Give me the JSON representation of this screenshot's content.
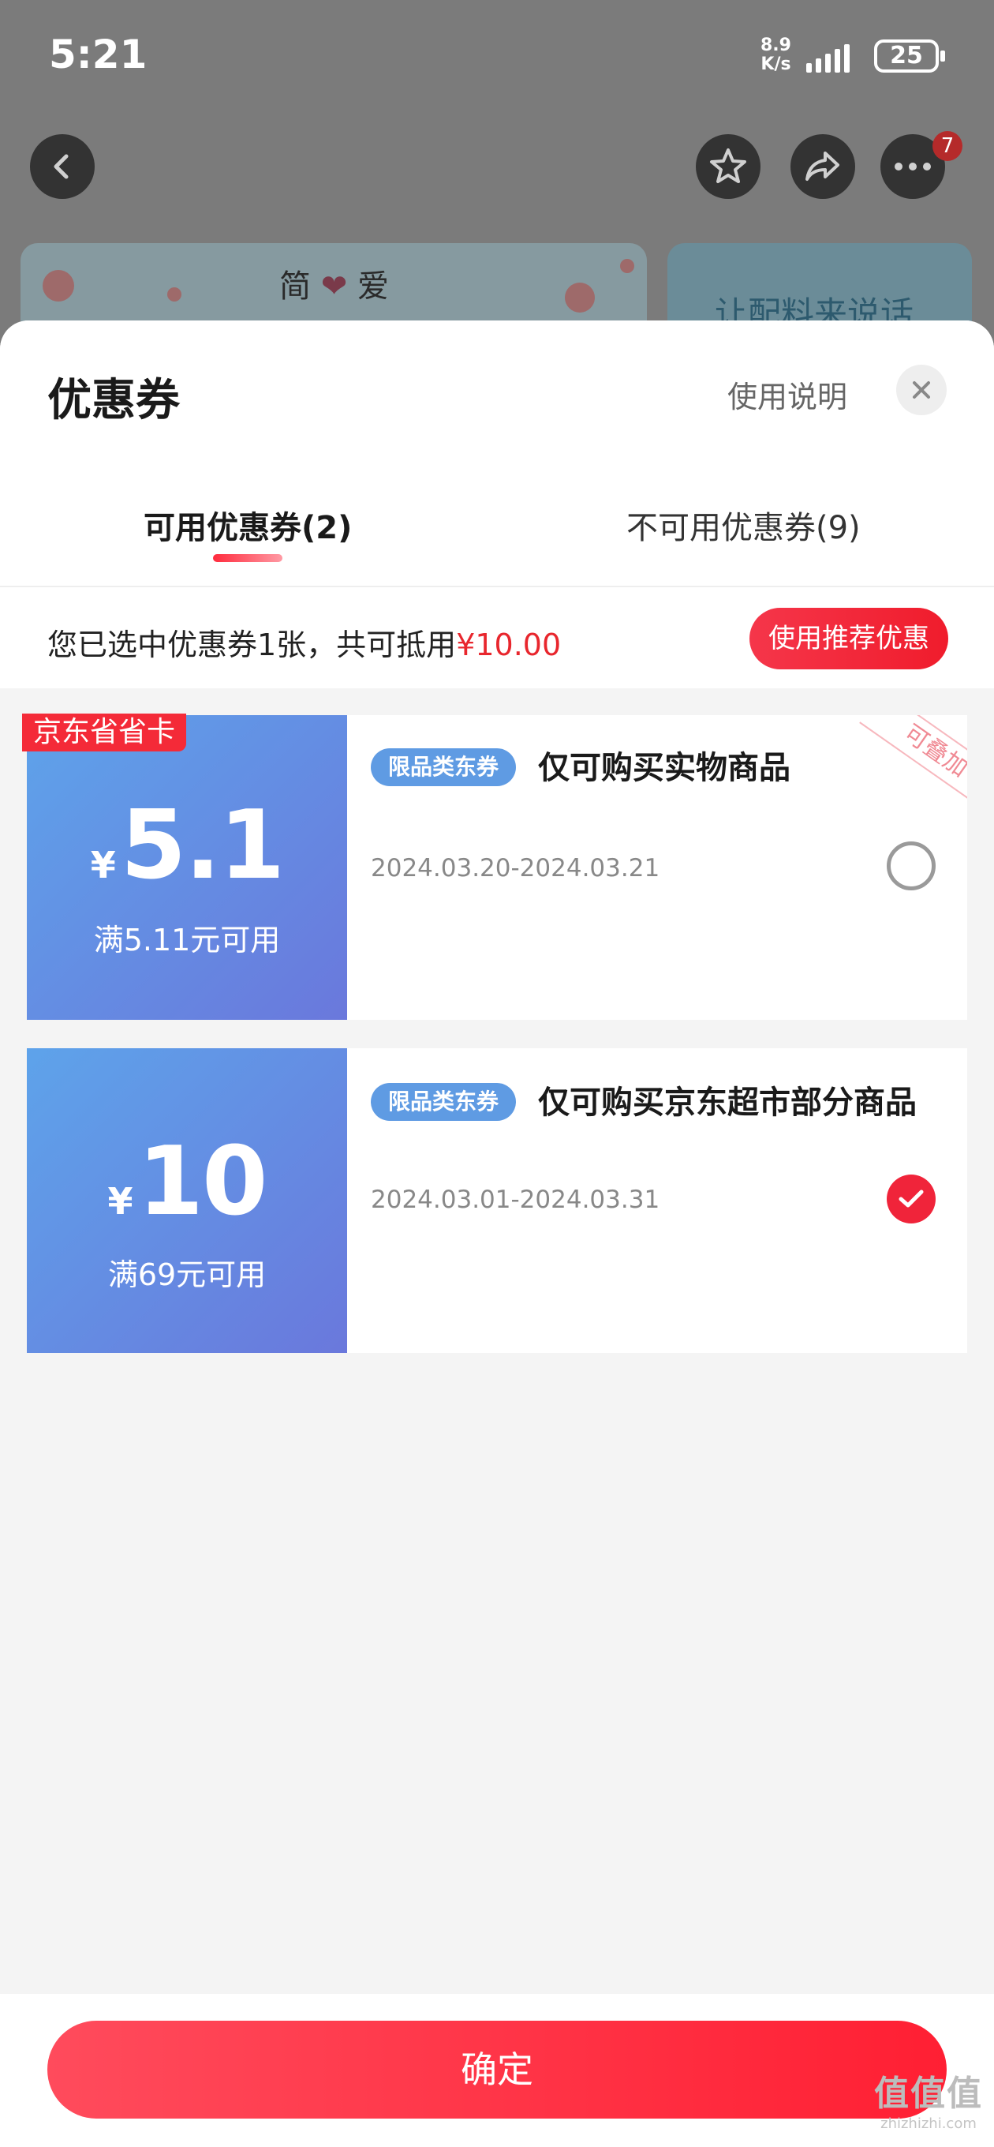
{
  "status_bar": {
    "time": "5:21",
    "net_speed_value": "8.9",
    "net_speed_unit": "K/s",
    "battery": "25"
  },
  "nav": {
    "badge_count": "7"
  },
  "background": {
    "banner_left_text": "简",
    "banner_left_text2": "爱",
    "banner_right_text": "让配料来说话"
  },
  "sheet": {
    "title": "优惠券",
    "help_link": "使用说明",
    "tabs": [
      {
        "label": "可用优惠券(2)",
        "active": true
      },
      {
        "label": "不可用优惠券(9)",
        "active": false
      }
    ],
    "summary_prefix": "您已选中优惠券1张，共可抵用",
    "summary_amount": "¥10.00",
    "recommend_label": "使用推荐优惠"
  },
  "coupons": [
    {
      "card_tag": "京东省省卡",
      "currency": "¥",
      "amount": "5.1",
      "condition": "满5.11元可用",
      "type_badge": "限品类东券",
      "title": "仅可购买实物商品",
      "validity": "2024.03.20-2024.03.21",
      "ribbon": "可叠加",
      "selected": false
    },
    {
      "currency": "¥",
      "amount": "10",
      "condition": "满69元可用",
      "type_badge": "限品类东券",
      "title": "仅可购买京东超市部分商品",
      "validity": "2024.03.01-2024.03.31",
      "selected": true
    }
  ],
  "footer": {
    "confirm_label": "确定",
    "watermark_logo": "值值值",
    "watermark_url": "zhizhizhi.com"
  },
  "colors": {
    "accent_red": "#f0243a",
    "coupon_blue_start": "#5ea3ea",
    "coupon_blue_end": "#6a78dc"
  }
}
